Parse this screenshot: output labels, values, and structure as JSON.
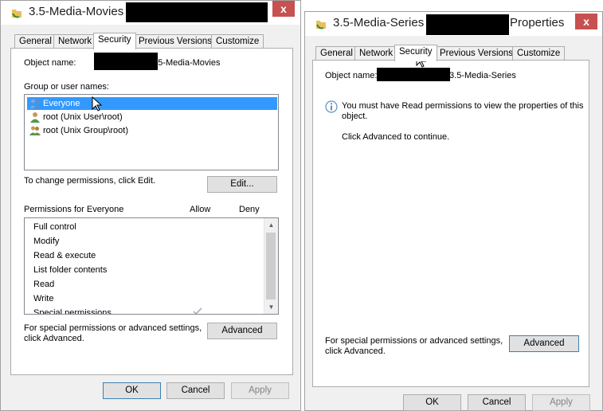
{
  "left": {
    "title": "3.5-Media-Movies",
    "close_glyph": "x",
    "tabs": [
      "General",
      "Network",
      "Security",
      "Previous Versions",
      "Customize"
    ],
    "object_name_label": "Object name:",
    "object_name_value": ".3.5-Media-Movies",
    "group_label": "Group or user names:",
    "users": [
      {
        "name": "Everyone",
        "icon": "users-group-icon",
        "selected": true
      },
      {
        "name": "root (Unix User\\root)",
        "icon": "user-icon",
        "selected": false
      },
      {
        "name": "root (Unix Group\\root)",
        "icon": "users-group-icon",
        "selected": false
      }
    ],
    "change_text": "To change permissions, click Edit.",
    "edit_label": "Edit...",
    "perm_header": "Permissions for Everyone",
    "allow_label": "Allow",
    "deny_label": "Deny",
    "permissions": [
      "Full control",
      "Modify",
      "Read & execute",
      "List folder contents",
      "Read",
      "Write",
      "Special permissions"
    ],
    "special_text_1": "For special permissions or advanced settings,",
    "special_text_2": "click Advanced.",
    "advanced_label": "Advanced",
    "ok_label": "OK",
    "cancel_label": "Cancel",
    "apply_label": "Apply"
  },
  "right": {
    "title_prefix": "3.5-Media-Series",
    "title_suffix": "Properties",
    "close_glyph": "x",
    "tabs": [
      "General",
      "Network",
      "Security",
      "Previous Versions",
      "Customize"
    ],
    "object_name_label": "Object name:",
    "object_name_value": ".3.5-Media-Series",
    "info_line_1": "You must have Read permissions to view the properties of this",
    "info_line_2": "object.",
    "continue_text": "Click Advanced to continue.",
    "special_text_1": "For special permissions or advanced settings,",
    "special_text_2": "click Advanced.",
    "advanced_label": "Advanced",
    "ok_label": "OK",
    "cancel_label": "Cancel",
    "apply_label": "Apply"
  }
}
